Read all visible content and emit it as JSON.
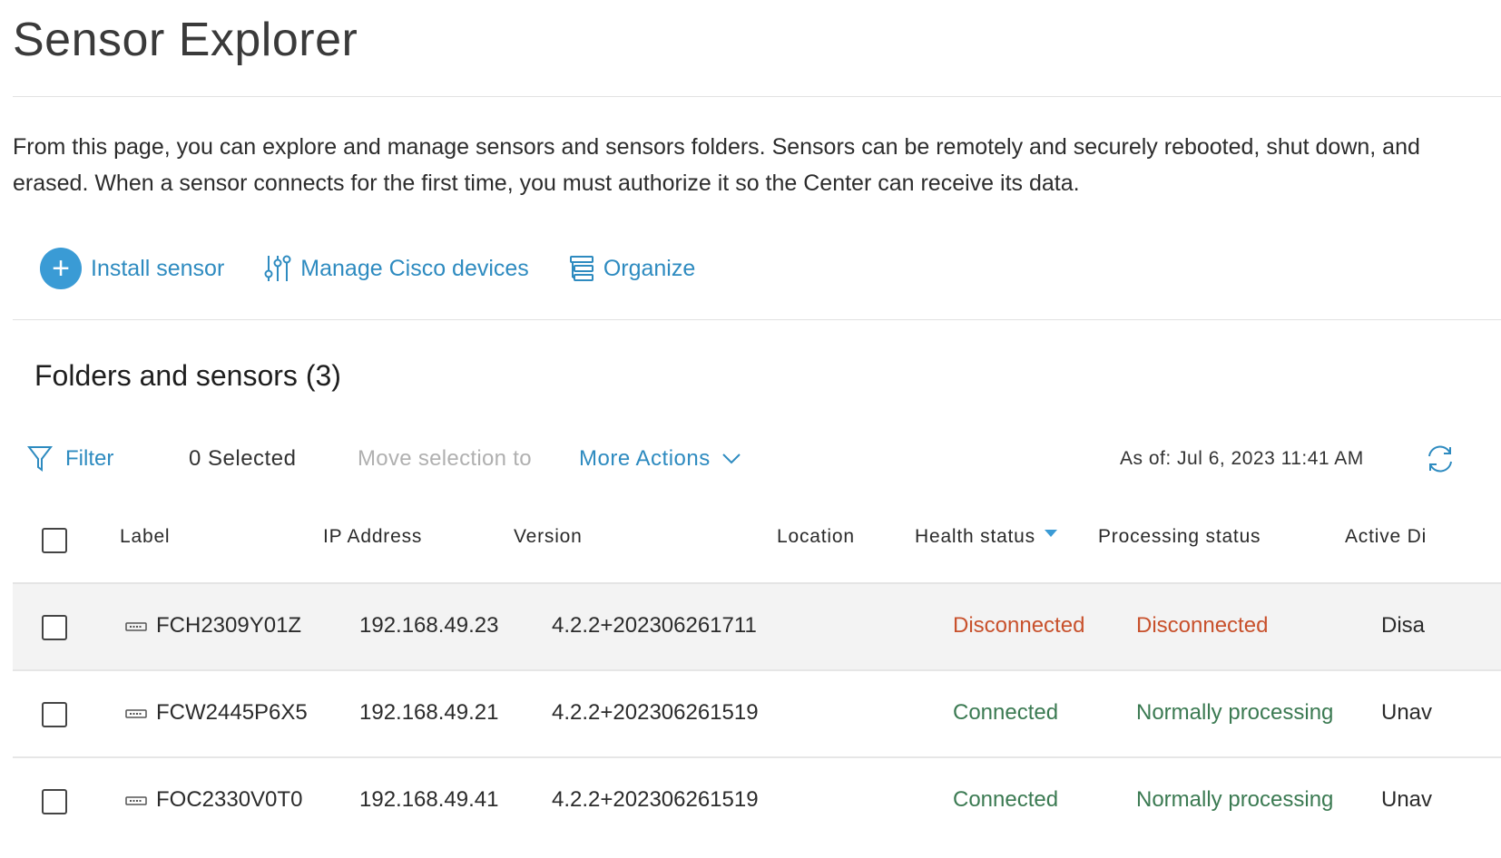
{
  "page": {
    "title": "Sensor Explorer",
    "description": "From this page, you can explore and manage sensors and sensors folders. Sensors can be remotely and securely rebooted, shut down, and erased. When a sensor connects for the first time, you must authorize it so the Center can receive its data."
  },
  "actions": {
    "install_sensor": "Install sensor",
    "manage_cisco_devices": "Manage Cisco devices",
    "organize": "Organize"
  },
  "section": {
    "title": "Folders and sensors (3)"
  },
  "toolbar": {
    "filter": "Filter",
    "selected": "0 Selected",
    "move_selection": "Move selection to",
    "more_actions": "More Actions",
    "as_of": "As of: Jul 6, 2023 11:41 AM"
  },
  "table": {
    "headers": {
      "label": "Label",
      "ip": "IP Address",
      "version": "Version",
      "location": "Location",
      "health": "Health status",
      "processing": "Processing status",
      "active": "Active Di"
    },
    "rows": [
      {
        "label": "FCH2309Y01Z",
        "ip": "192.168.49.23",
        "version": "4.2.2+202306261711",
        "location": "",
        "health": "Disconnected",
        "processing": "Disconnected",
        "active": "Disa"
      },
      {
        "label": "FCW2445P6X5",
        "ip": "192.168.49.21",
        "version": "4.2.2+202306261519",
        "location": "",
        "health": "Connected",
        "processing": "Normally processing",
        "active": "Unav"
      },
      {
        "label": "FOC2330V0T0",
        "ip": "192.168.49.41",
        "version": "4.2.2+202306261519",
        "location": "",
        "health": "Connected",
        "processing": "Normally processing",
        "active": "Unav"
      }
    ]
  },
  "colors": {
    "accent": "#2e8bc0",
    "status_bad": "#c8512c",
    "status_good": "#3b7a52"
  },
  "icons": {
    "install": "plus-circle-icon",
    "manage": "sliders-icon",
    "organize": "list-icon",
    "filter": "funnel-icon",
    "more": "chevron-down-icon",
    "refresh": "refresh-icon",
    "device": "sensor-device-icon"
  }
}
